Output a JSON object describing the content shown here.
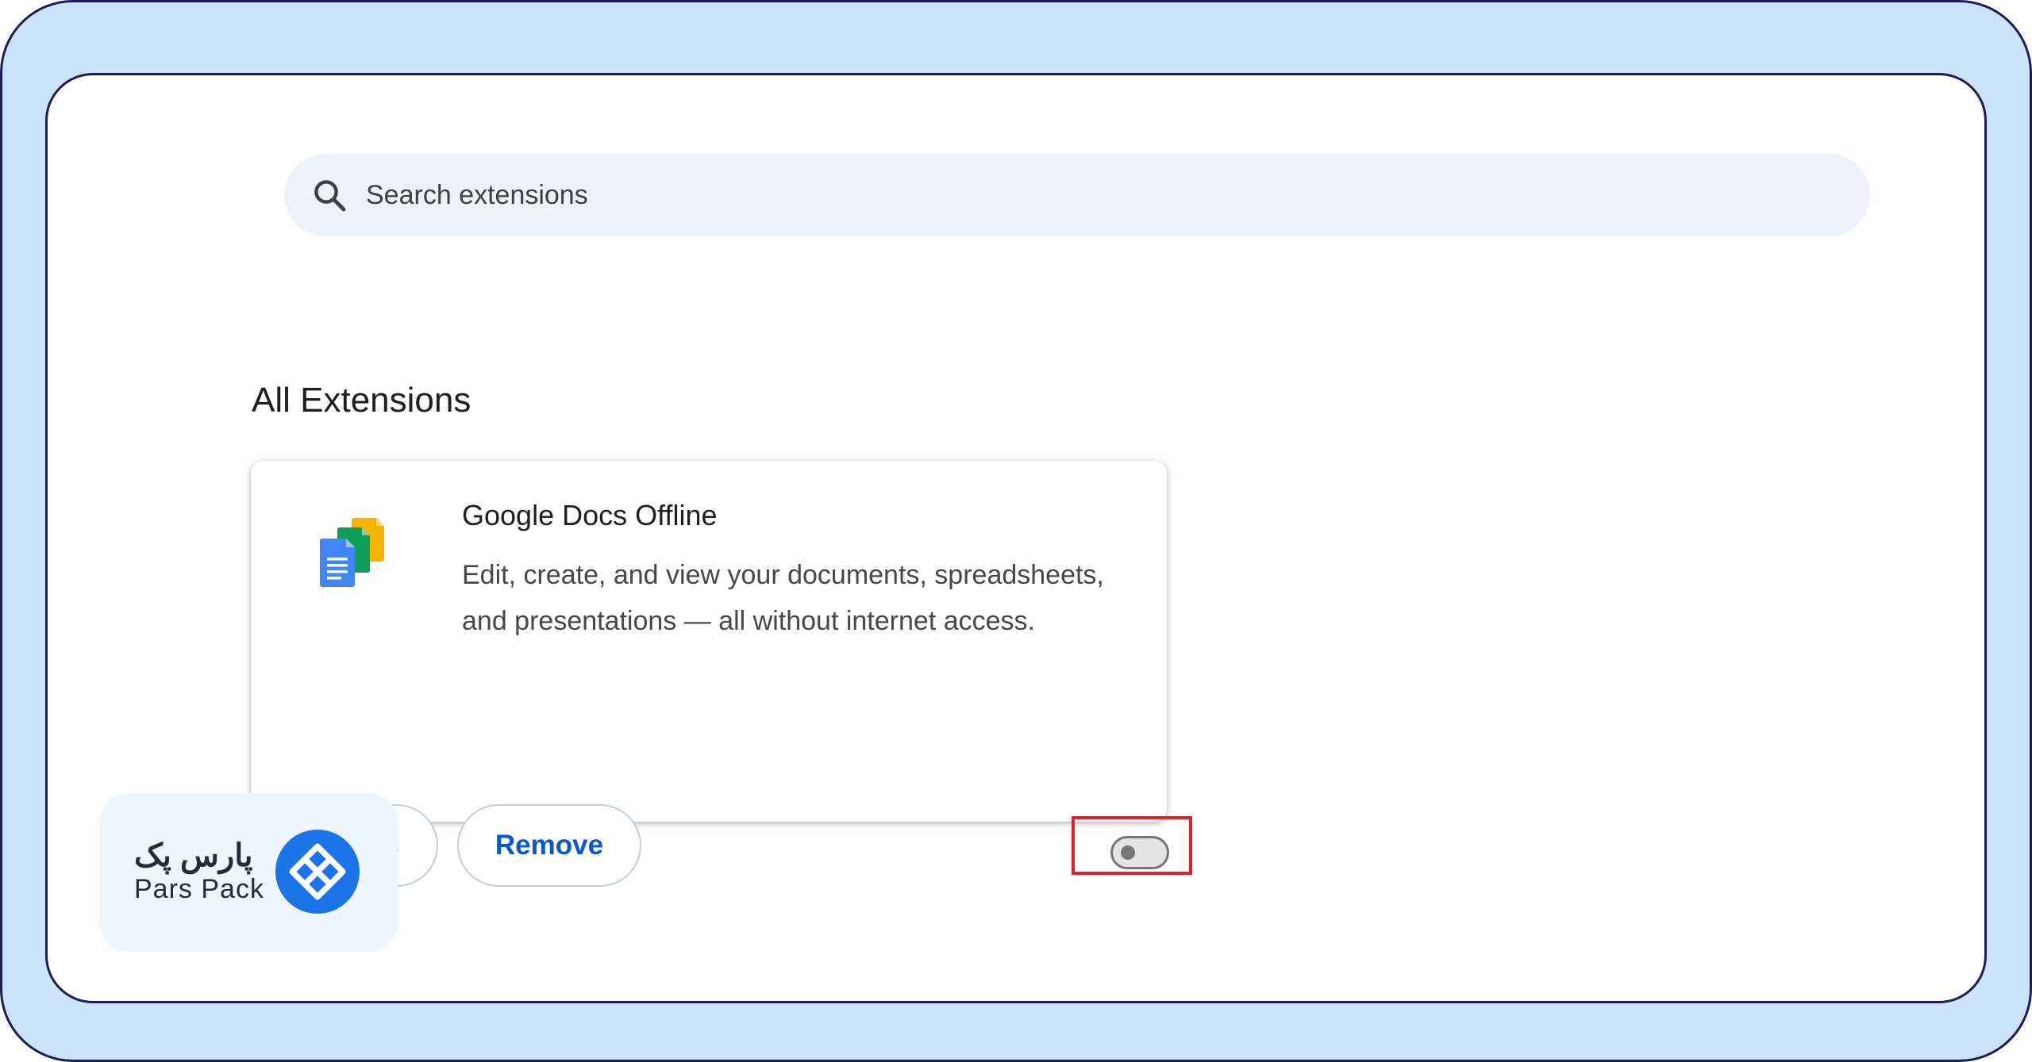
{
  "search": {
    "placeholder": "Search extensions",
    "icon": "search-icon"
  },
  "section": {
    "title": "All Extensions"
  },
  "extension": {
    "name": "Google Docs Offline",
    "description": "Edit, create, and view your documents, spreadsheets, and presentations — all without internet access.",
    "icon": "google-docs-offline-icon",
    "details_label": "Details",
    "remove_label": "Remove",
    "enabled": false,
    "toggle_highlight_color": "#e0202a"
  },
  "watermark": {
    "brand_fa": "پارس پک",
    "brand_en": "Pars Pack",
    "brand_color": "#1b74e8"
  },
  "colors": {
    "frame_background": "#cbe4fb",
    "frame_border": "#1f1a5a",
    "button_text": "#0b57d0",
    "search_background": "#edf1fa"
  }
}
